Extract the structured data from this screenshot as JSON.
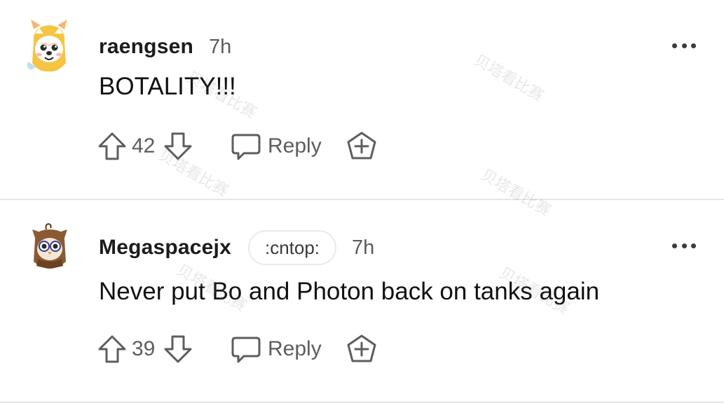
{
  "comments": [
    {
      "username": "raengsen",
      "flair": "",
      "time": "7h",
      "body": "BOTALITY!!!",
      "votes": "42",
      "reply_label": "Reply",
      "avatar_icon": "shiba-dog-costume-avatar",
      "more_icon": "more-options-icon"
    },
    {
      "username": "Megaspacejx",
      "flair": ":cntop:",
      "time": "7h",
      "body": "Never put Bo and Photon back on tanks again",
      "votes": "39",
      "reply_label": "Reply",
      "avatar_icon": "owl-costume-avatar",
      "more_icon": "more-options-icon"
    }
  ],
  "watermark_text": "贝塔看比赛",
  "colors": {
    "text_primary": "#1c1c1c",
    "text_secondary": "#5d5d5d",
    "divider": "#e6e6e6",
    "flair_border": "#e9e9e9"
  }
}
